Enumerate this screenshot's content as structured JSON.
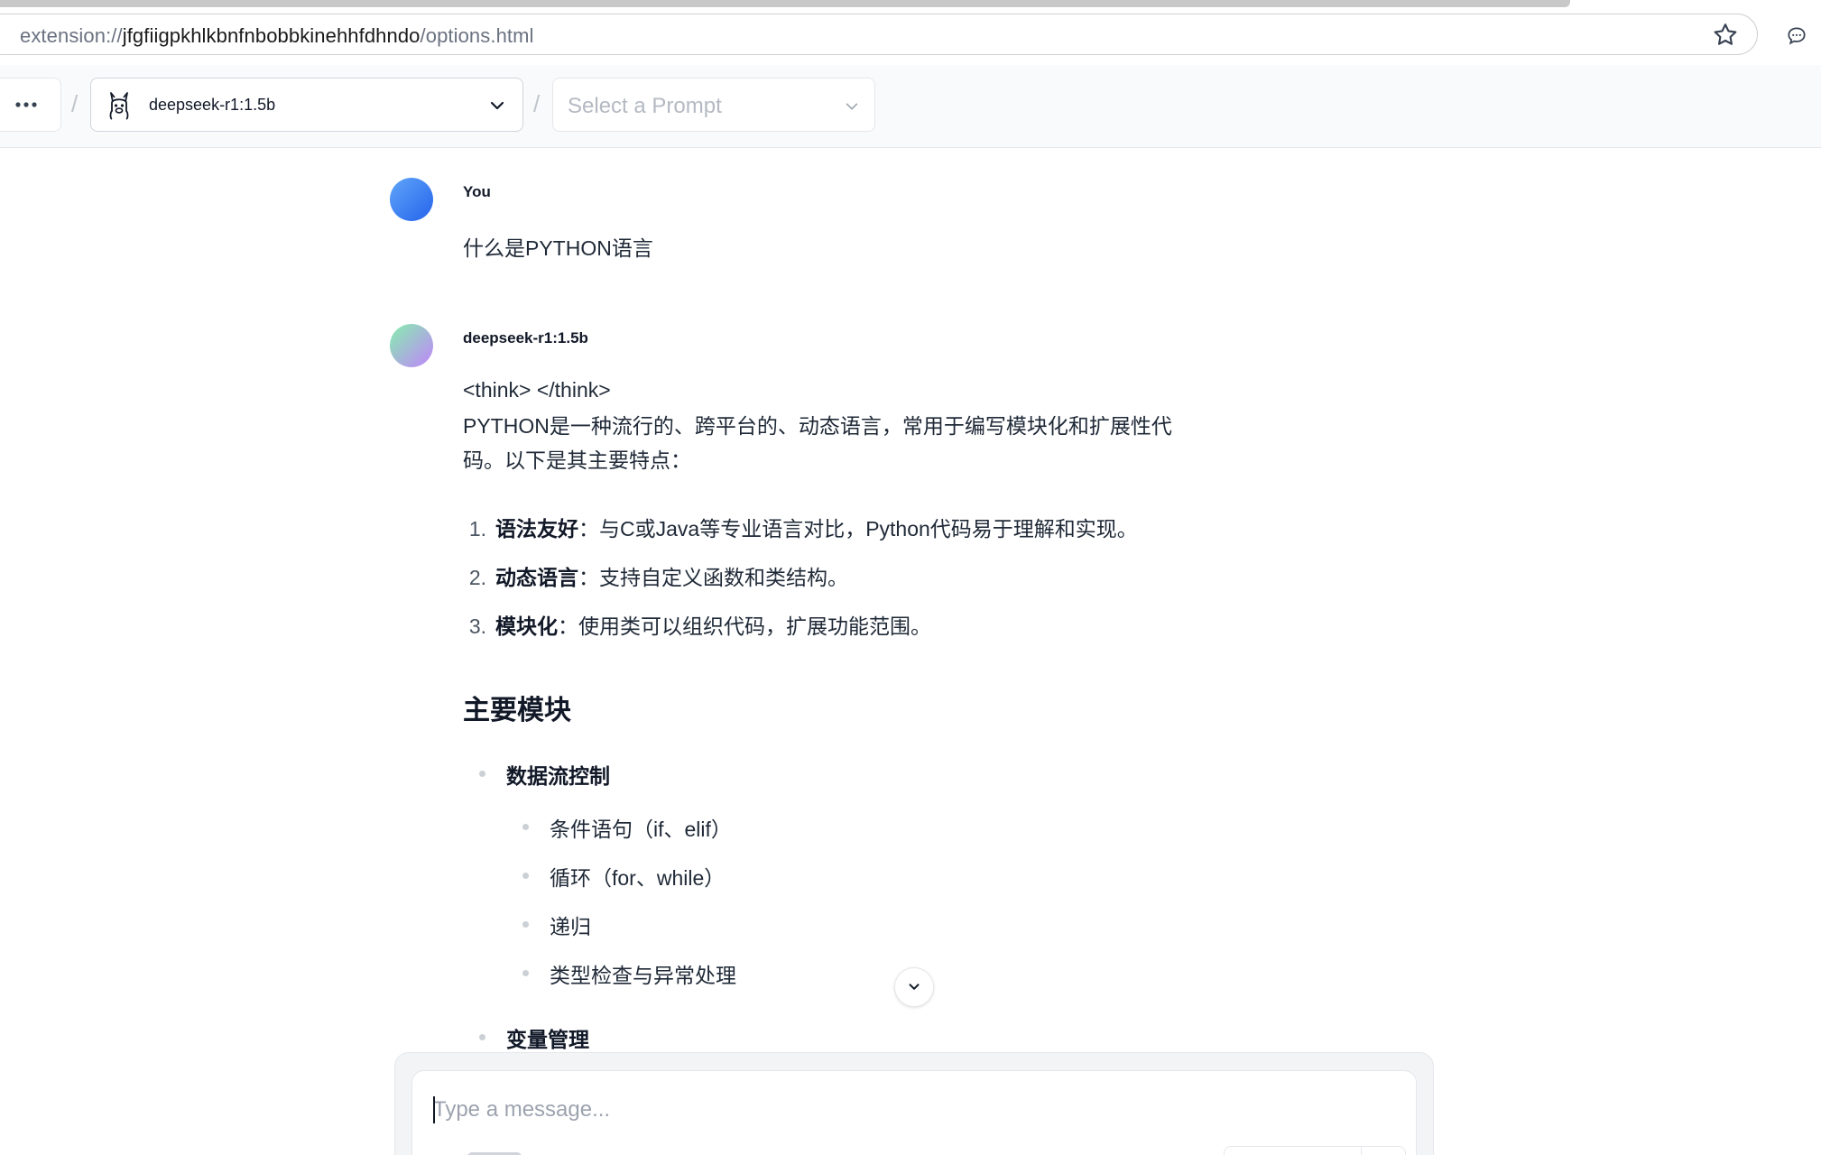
{
  "browser": {
    "url_scheme": "extension://",
    "url_host": "jfgfiigpkhlkbnfnbobbkinehhfdhndo",
    "url_path": "/options.html",
    "bookmark_icon": "star-icon",
    "side_icon": "chat-bubble-icon"
  },
  "header": {
    "more_icon": "ellipsis-icon",
    "separator": "/",
    "model": {
      "icon": "llama-icon",
      "label": "deepseek-r1:1.5b",
      "chevron_icon": "chevron-down-icon"
    },
    "prompt": {
      "placeholder": "Select a Prompt",
      "chevron_icon": "chevron-down-icon"
    }
  },
  "messages": [
    {
      "sender": "You",
      "text": "什么是PYTHON语言"
    },
    {
      "sender": "deepseek-r1:1.5b",
      "think": "<think> </think>",
      "intro": "PYTHON是一种流行的、跨平台的、动态语言，常用于编写模块化和扩展性代码。以下是其主要特点：",
      "features": [
        {
          "num": "1.",
          "title": "语法友好",
          "desc": "：与C或Java等专业语言对比，Python代码易于理解和实现。"
        },
        {
          "num": "2.",
          "title": "动态语言",
          "desc": "：支持自定义函数和类结构。"
        },
        {
          "num": "3.",
          "title": "模块化",
          "desc": "：使用类可以组织代码，扩展功能范围。"
        }
      ],
      "section_heading": "主要模块",
      "modules": [
        {
          "title": "数据流控制",
          "items": [
            "条件语句（if、elif）",
            "循环（for、while）",
            "递归",
            "类型检查与异常处理"
          ]
        },
        {
          "title": "变量管理",
          "items": []
        }
      ]
    }
  ],
  "composer": {
    "placeholder": "Type a message..."
  },
  "colors": {
    "user_avatar": "#2563eb",
    "bot_avatar_start": "#86efac",
    "bot_avatar_end": "#c084fc",
    "header_bg": "#f9fafb"
  }
}
